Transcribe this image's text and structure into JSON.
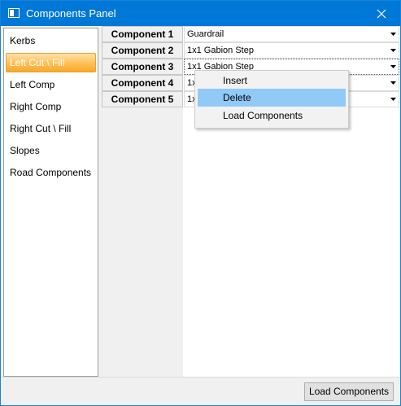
{
  "window": {
    "title": "Components Panel"
  },
  "sidebar": {
    "items": [
      {
        "label": "Kerbs"
      },
      {
        "label": "Left Cut \\ Fill",
        "selected": true
      },
      {
        "label": "Left Comp"
      },
      {
        "label": "Right Comp"
      },
      {
        "label": "Right Cut \\ Fill"
      },
      {
        "label": "Slopes"
      },
      {
        "label": "Road Components"
      }
    ]
  },
  "grid": {
    "rows": [
      {
        "label": "Component 1",
        "value": "Guardrail"
      },
      {
        "label": "Component 2",
        "value": "1x1 Gabion Step"
      },
      {
        "label": "Component 3",
        "value": "1x1 Gabion Step"
      },
      {
        "label": "Component 4",
        "value": "1x"
      },
      {
        "label": "Component 5",
        "value": "1x"
      }
    ]
  },
  "context_menu": {
    "items": [
      {
        "label": "Insert"
      },
      {
        "label": "Delete",
        "highlighted": true
      },
      {
        "label": "Load Components"
      }
    ]
  },
  "footer": {
    "load_button": "Load Components"
  },
  "icons": {
    "app": "window-icon",
    "close": "close-icon",
    "dropdown": "chevron-down-icon"
  },
  "colors": {
    "titlebar": "#0078d7",
    "selection": "#f7a829",
    "menu_highlight": "#91c9f7"
  }
}
